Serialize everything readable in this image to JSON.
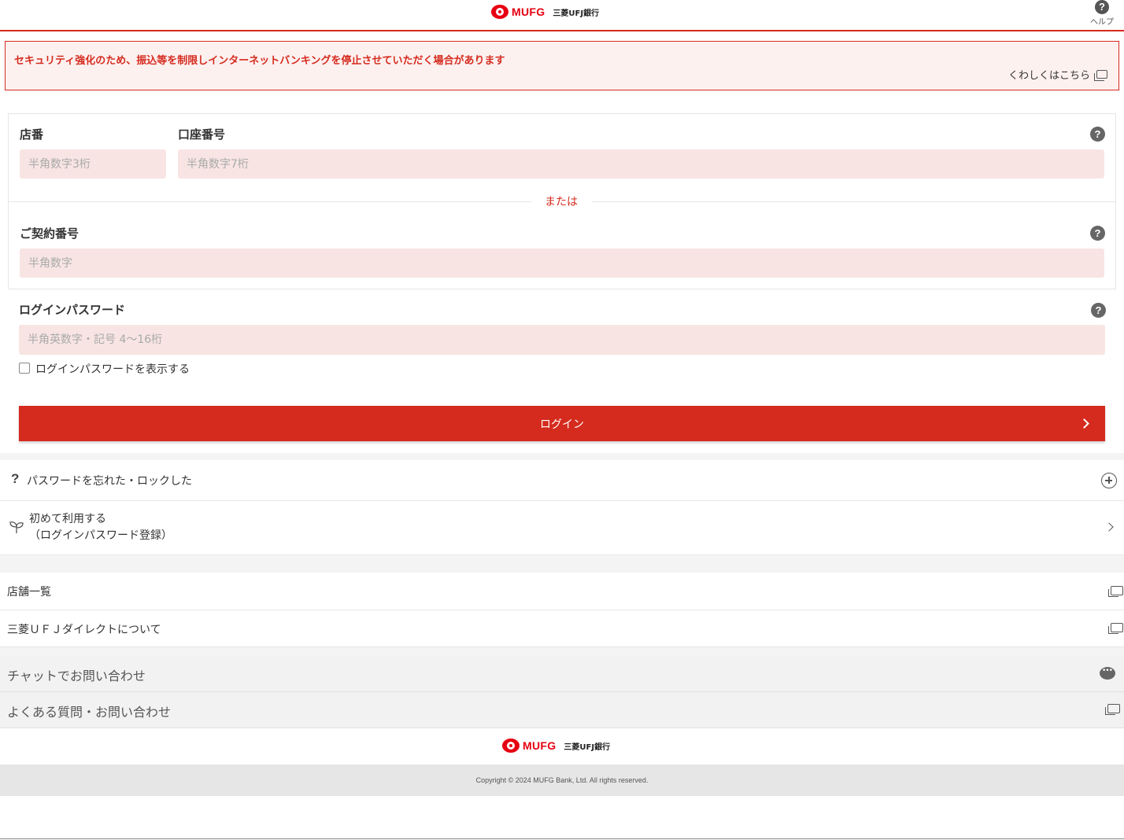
{
  "header": {
    "logo_text": "MUFG",
    "logo_sub": "三菱UFJ銀行",
    "help_label": "ヘルプ"
  },
  "alert": {
    "message": "セキュリティ強化のため、振込等を制限しインターネットバンキングを停止させていただく場合があります",
    "link_label": "くわしくはこちら"
  },
  "form": {
    "branch_label": "店番",
    "branch_placeholder": "半角数字3桁",
    "account_label": "口座番号",
    "account_placeholder": "半角数字7桁",
    "or_text": "または",
    "contract_label": "ご契約番号",
    "contract_placeholder": "半角数字",
    "password_label": "ログインパスワード",
    "password_placeholder": "半角英数字・記号 4〜16桁",
    "show_password_label": "ログインパスワードを表示する",
    "login_button": "ログイン"
  },
  "links": {
    "forgot_password": "パスワードを忘れた・ロックした",
    "first_time_line1": "初めて利用する",
    "first_time_line2": "（ログインパスワード登録）",
    "branch_list": "店舗一覧",
    "about_direct": "三菱ＵＦＪダイレクトについて",
    "chat_inquiry": "チャットでお問い合わせ",
    "faq_inquiry": "よくある質問・お問い合わせ"
  },
  "footer": {
    "logo_text": "MUFG",
    "logo_sub": "三菱UFJ銀行",
    "copyright": "Copyright © 2024 MUFG Bank, Ltd. All rights reserved."
  },
  "colors": {
    "brand_red": "#d52b1e",
    "input_bg": "#f7e4e3",
    "alert_bg": "#fdf1f0"
  }
}
